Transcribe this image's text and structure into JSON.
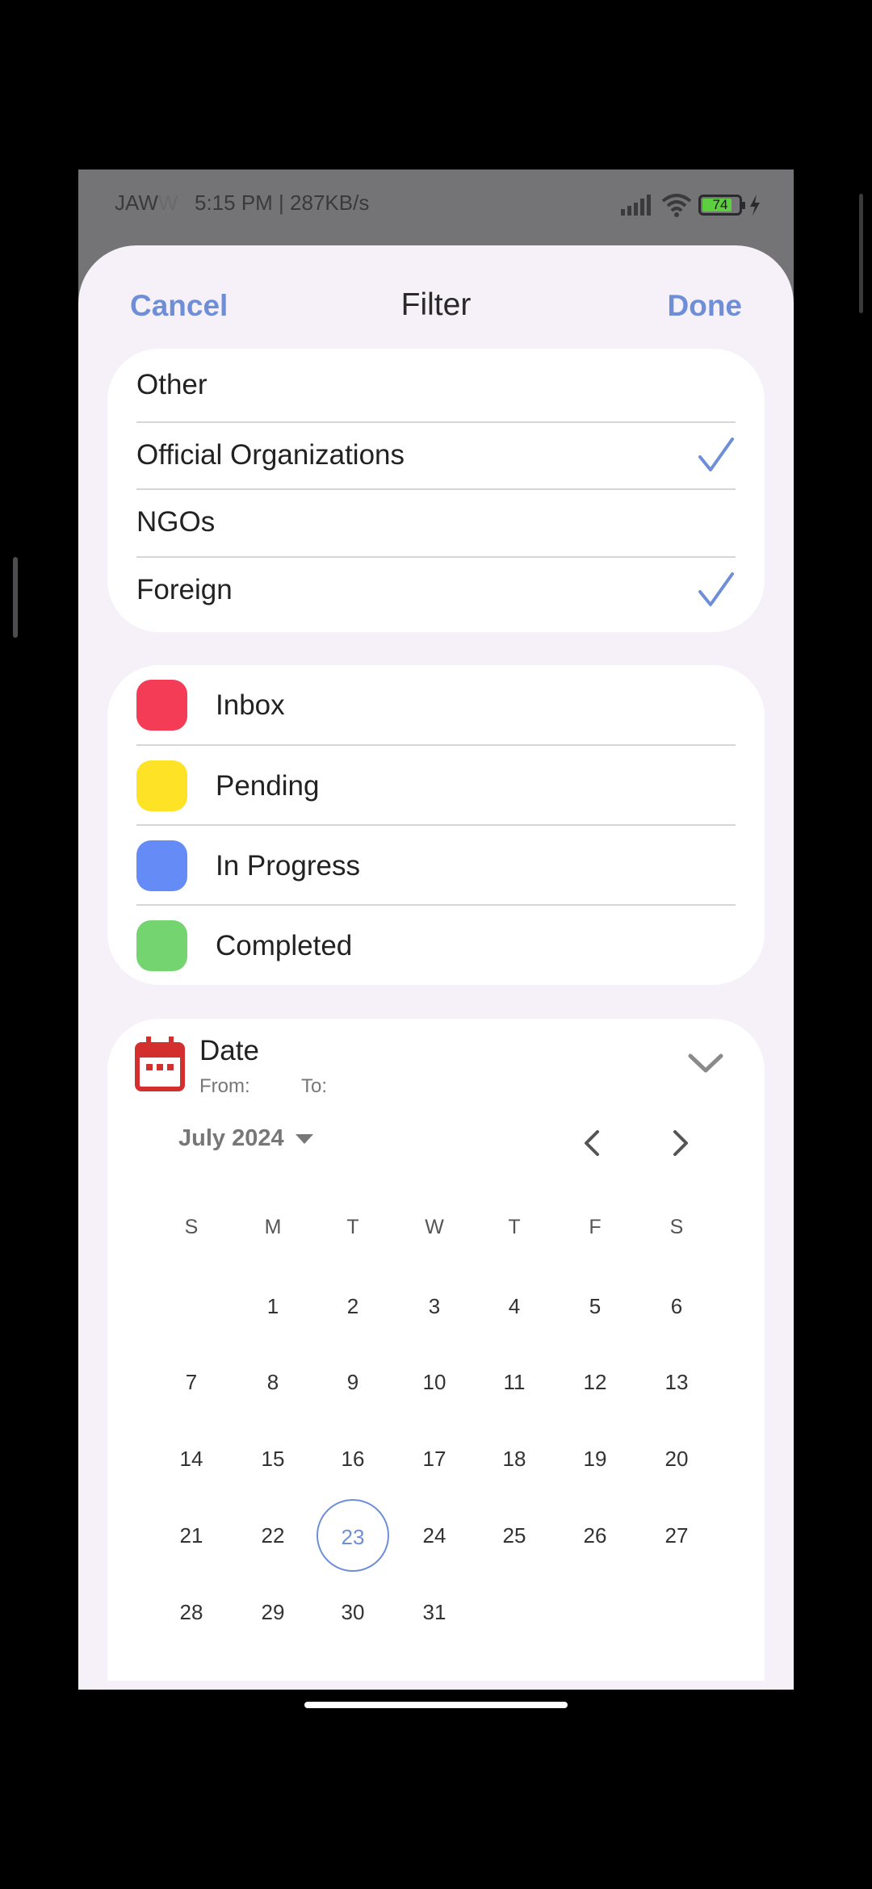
{
  "status_bar": {
    "carrier_a": "JAW",
    "carrier_b": "W",
    "time_speed": "5:15 PM | 287KB/s",
    "battery": "74",
    "icons": [
      "signal-icon",
      "wifi-icon",
      "battery-icon",
      "charging-icon"
    ]
  },
  "header": {
    "cancel_label": "Cancel",
    "title": "Filter",
    "done_label": "Done"
  },
  "categories": [
    {
      "label": "Other",
      "checked": false
    },
    {
      "label": "Official Organizations",
      "checked": true
    },
    {
      "label": "NGOs",
      "checked": false
    },
    {
      "label": "Foreign",
      "checked": true
    }
  ],
  "statuses": [
    {
      "label": "Inbox",
      "color": "#f43c57"
    },
    {
      "label": "Pending",
      "color": "#fde225"
    },
    {
      "label": "In Progress",
      "color": "#658bf7"
    },
    {
      "label": "Completed",
      "color": "#74d46f"
    }
  ],
  "date_filter": {
    "label": "Date",
    "from_label": "From:",
    "to_label": "To:",
    "month_label": "July 2024",
    "weekdays": [
      "S",
      "M",
      "T",
      "W",
      "T",
      "F",
      "S"
    ],
    "weeks": [
      [
        "",
        "1",
        "2",
        "3",
        "4",
        "5",
        "6"
      ],
      [
        "7",
        "8",
        "9",
        "10",
        "11",
        "12",
        "13"
      ],
      [
        "14",
        "15",
        "16",
        "17",
        "18",
        "19",
        "20"
      ],
      [
        "21",
        "22",
        "23",
        "24",
        "25",
        "26",
        "27"
      ],
      [
        "28",
        "29",
        "30",
        "31",
        "",
        "",
        ""
      ]
    ],
    "today": "23"
  },
  "colors": {
    "accent": "#6e8fd8",
    "sheet_bg": "#f6f1f9",
    "calendar_icon": "#d32f2f"
  }
}
